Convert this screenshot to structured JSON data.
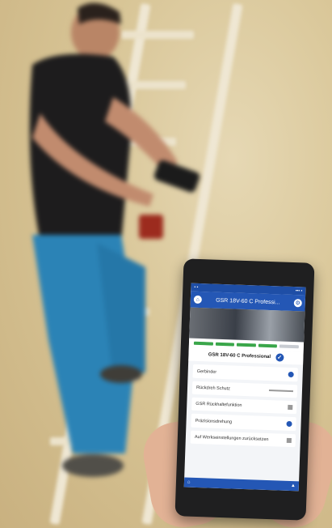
{
  "scene": {
    "description_colors": {
      "wall": "#d8c596",
      "shirt": "#1c1b1c",
      "jeans": "#2a7fb0",
      "app_blue": "#2457b5",
      "progress_green": "#3aa64a"
    }
  },
  "app": {
    "title": "GSR 18V-60 C Professi...",
    "device_name": "GSR 18V-60 C Professional",
    "progress": [
      true,
      true,
      true,
      true,
      false
    ],
    "settings": [
      {
        "label": "Gerbinder",
        "control": "toggle"
      },
      {
        "label": "Rückdreh Schutz",
        "control": "slider"
      },
      {
        "label": "GSR Rückhaltefunktion",
        "control": "value"
      },
      {
        "label": "Präzisionsdrehung",
        "control": "toggle"
      },
      {
        "label": "Auf Werkseinstellungen zurücksetzen",
        "control": "value"
      }
    ]
  }
}
